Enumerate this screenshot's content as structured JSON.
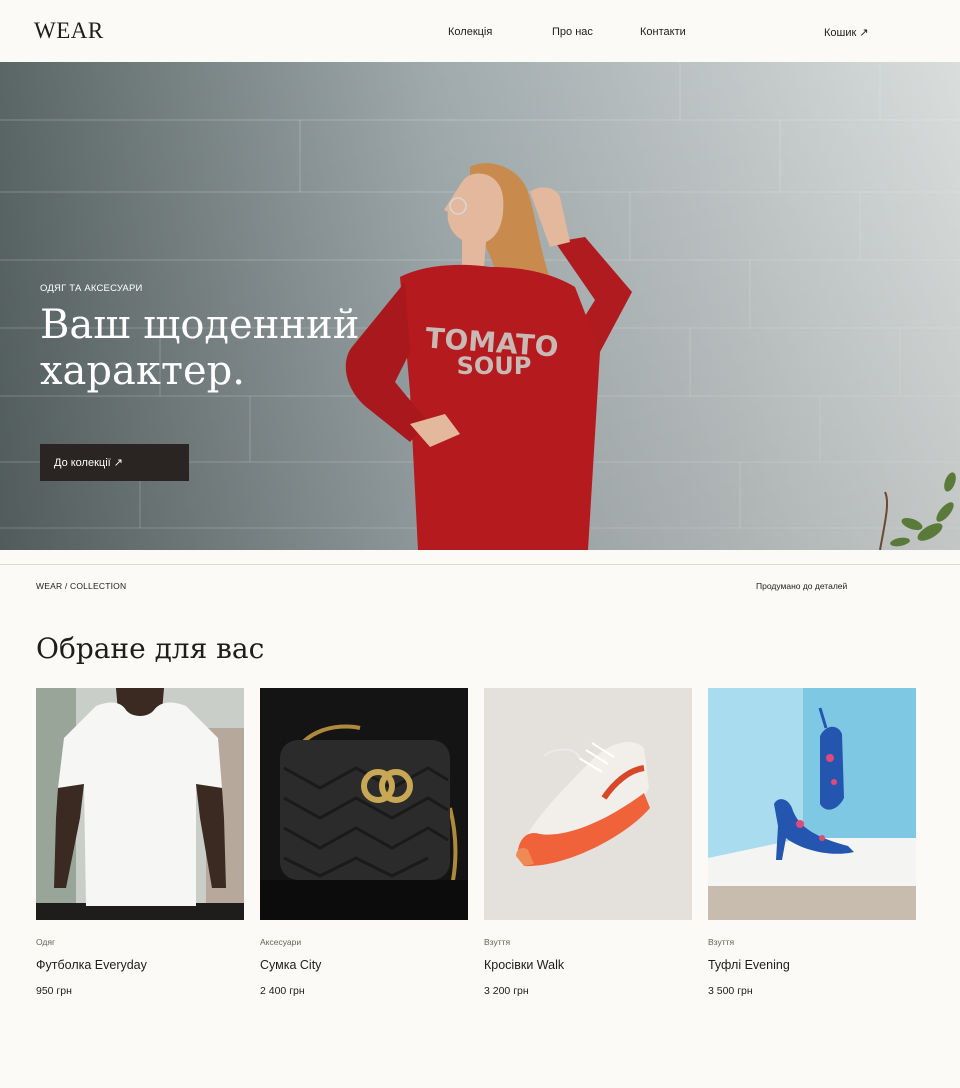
{
  "header": {
    "logo": "WEAR",
    "nav": {
      "collection": "Колекція",
      "about": "Про нас",
      "contacts": "Контакти",
      "cart": "Кошик ↗"
    }
  },
  "hero": {
    "eyebrow": "ОДЯГ ТА АКСЕСУАРИ",
    "title": "Ваш щоденний характер.",
    "cta": "До колекції ↗",
    "shirt_text_1": "TOMATO",
    "shirt_text_2": "SOUP"
  },
  "meta": {
    "breadcrumb": "WEAR / COLLECTION",
    "tagline": "Продумано до деталей"
  },
  "products": {
    "title": "Обране для вас",
    "items": [
      {
        "category": "Одяг",
        "name": "Футболка Everyday",
        "price": "950 грн",
        "icon": "tshirt-photo"
      },
      {
        "category": "Аксесуари",
        "name": "Сумка City",
        "price": "2 400 грн",
        "icon": "bag-photo"
      },
      {
        "category": "Взуття",
        "name": "Кросівки Walk",
        "price": "3 200 грн",
        "icon": "sneaker-photo"
      },
      {
        "category": "Взуття",
        "name": "Туфлі Evening",
        "price": "3 500 грн",
        "icon": "heels-photo"
      }
    ]
  },
  "colors": {
    "background": "#fbfaf6",
    "button": "#2a2422",
    "sweater": "#b51a1e"
  }
}
